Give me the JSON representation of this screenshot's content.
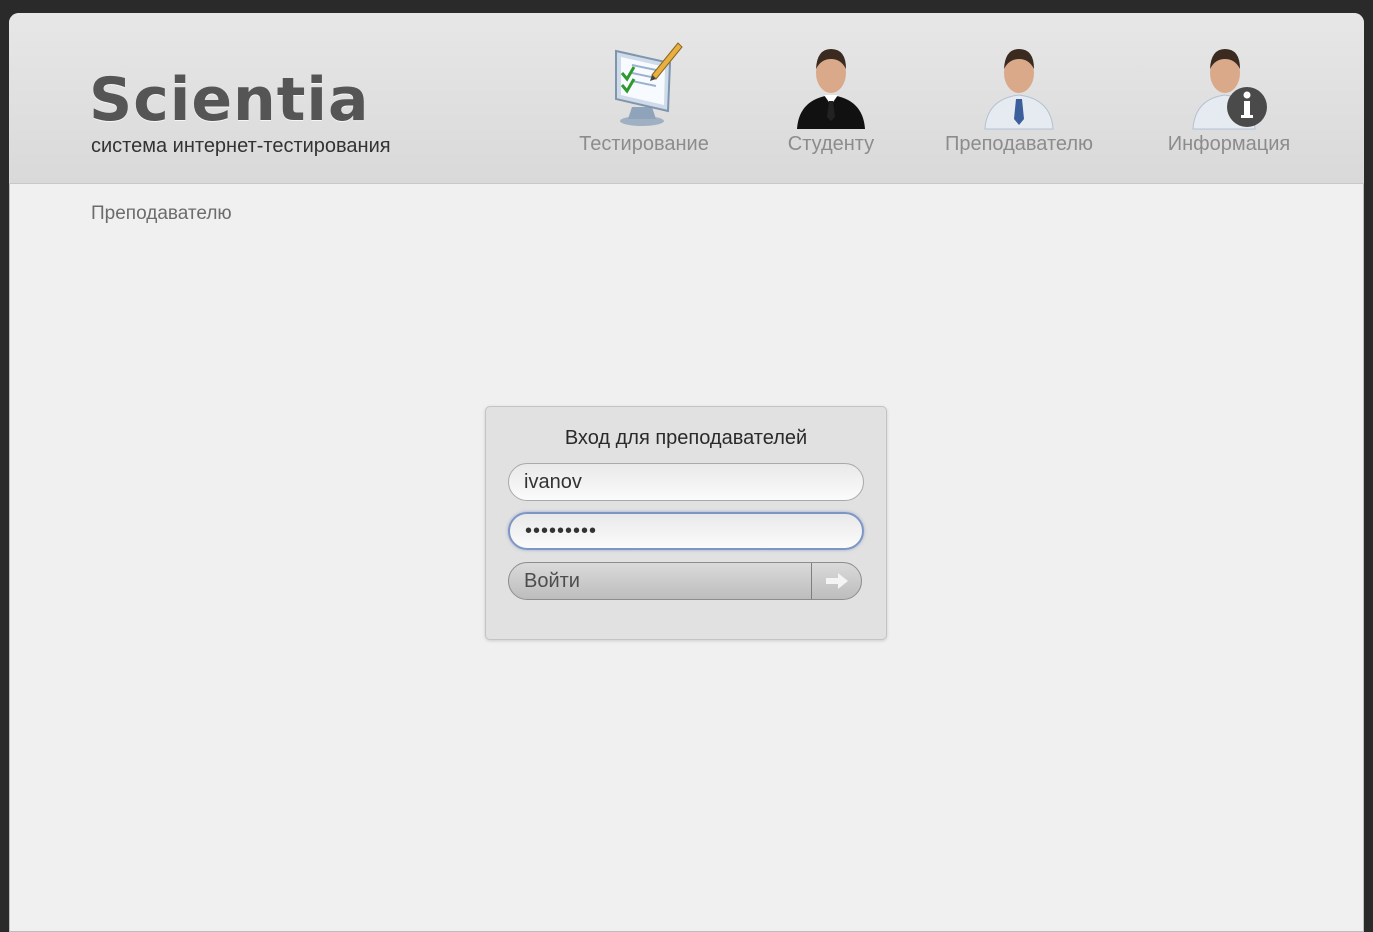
{
  "header": {
    "brand_title": "Scientia",
    "brand_subtitle": "система интернет-тестирования",
    "nav": [
      {
        "label": "Тестирование",
        "icon": "testing-monitor-icon"
      },
      {
        "label": "Студенту",
        "icon": "student-avatar-icon"
      },
      {
        "label": "Преподавателю",
        "icon": "teacher-avatar-icon"
      },
      {
        "label": "Информация",
        "icon": "info-avatar-icon"
      }
    ]
  },
  "breadcrumb": "Преподавателю",
  "login": {
    "title": "Вход для преподавателей",
    "username_value": "ivanov",
    "password_value": "•••••••••",
    "submit_label": "Войти",
    "submit_icon": "arrow-right-icon"
  }
}
